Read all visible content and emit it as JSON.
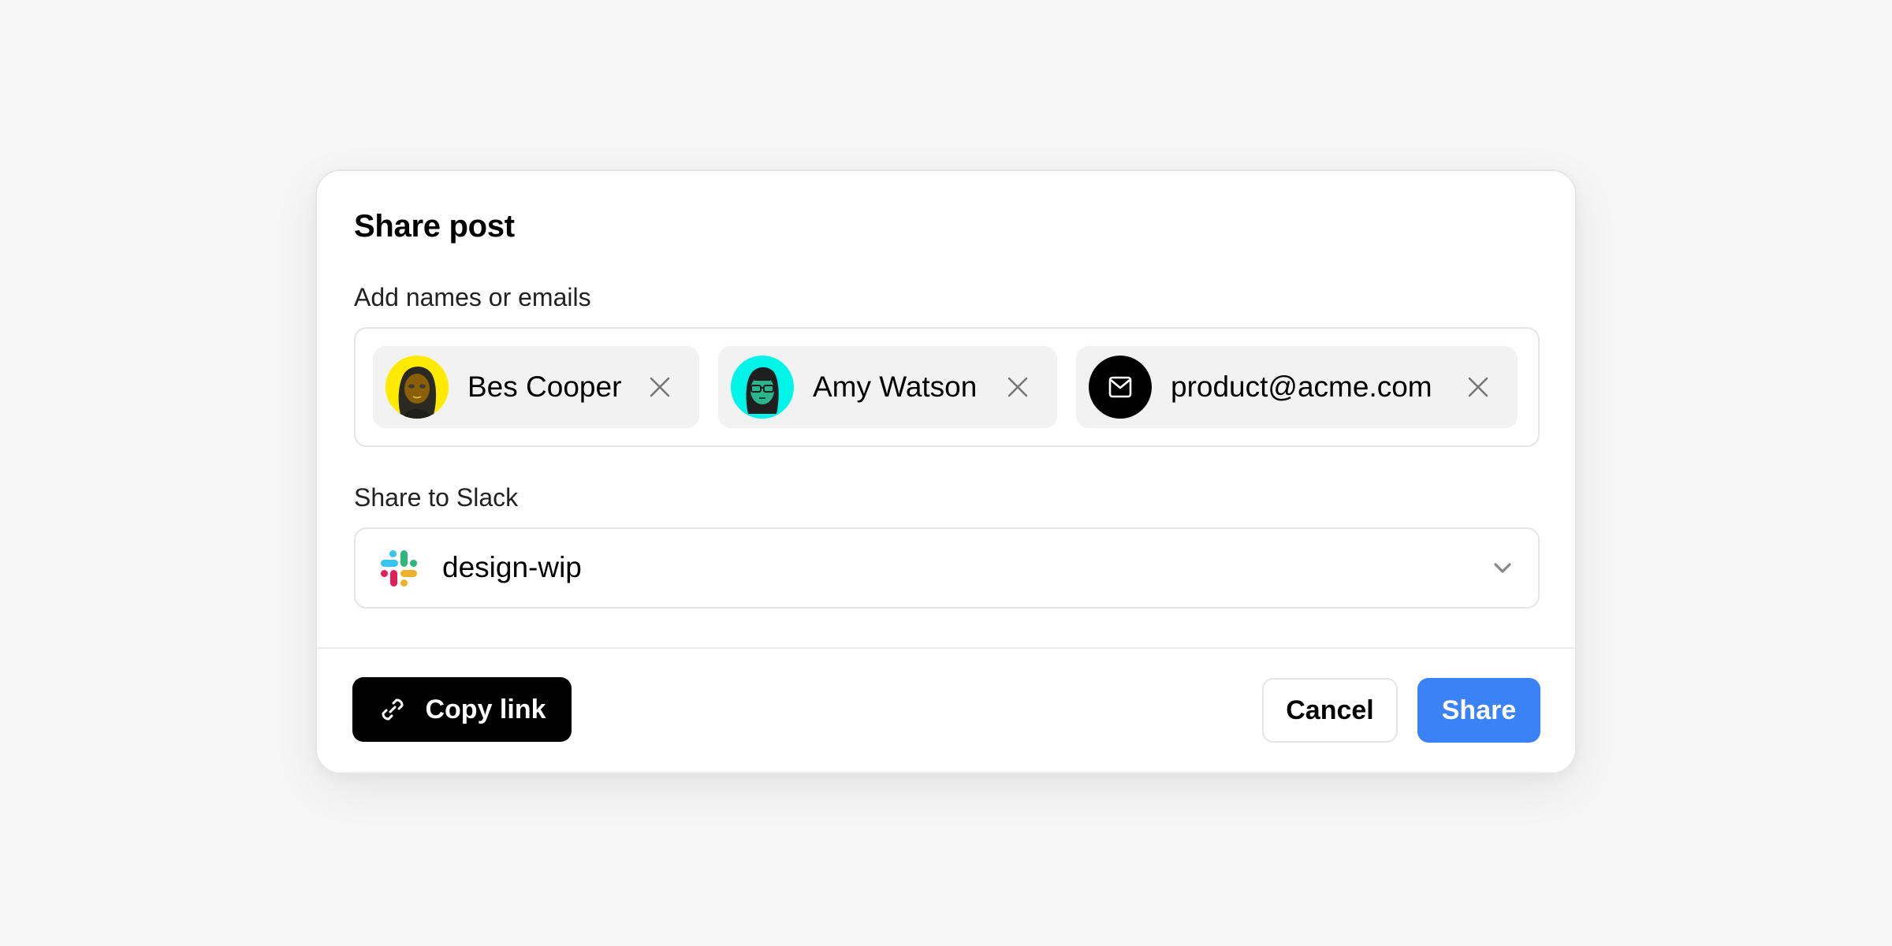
{
  "dialog": {
    "title": "Share post",
    "names_label": "Add names or emails",
    "recipients": [
      {
        "name": "Bes Cooper",
        "type": "user",
        "avatar": "memoji-avatar",
        "avatar_bg": "#FFEA00"
      },
      {
        "name": "Amy Watson",
        "type": "user",
        "avatar": "memoji-avatar",
        "avatar_bg": "#00F5E9"
      },
      {
        "name": "product@acme.com",
        "type": "email",
        "avatar": "mail-icon",
        "avatar_bg": "#000000"
      }
    ],
    "remove_icon": "close-icon",
    "slack_label": "Share to Slack",
    "slack_channel": "design-wip",
    "slack_icon": "slack-logo",
    "dropdown_icon": "chevron-down-icon"
  },
  "footer": {
    "copy_link_label": "Copy link",
    "copy_link_icon": "link-icon",
    "cancel_label": "Cancel",
    "share_label": "Share"
  },
  "colors": {
    "primary": "#3B82F6",
    "dark_button": "#000000",
    "chip_bg": "#F2F2F2",
    "border": "#E5E5E5",
    "page_bg": "#F6F6F6"
  }
}
